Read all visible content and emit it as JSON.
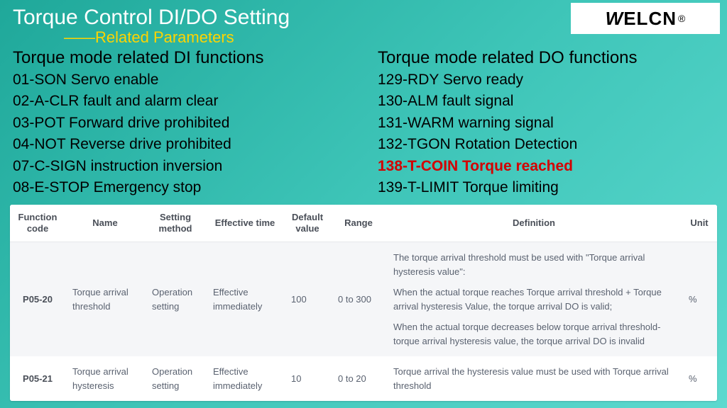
{
  "logo": {
    "mark": "W",
    "text": "ELCN",
    "reg": "®"
  },
  "title": "Torque Control DI/DO Setting",
  "subtitle": "——Related Parameters",
  "left": {
    "heading": "Torque mode related DI functions",
    "items": [
      "01-SON Servo enable",
      "02-A-CLR fault and alarm clear",
      "03-POT Forward drive prohibited",
      "04-NOT Reverse drive prohibited",
      "07-C-SIGN instruction inversion",
      "08-E-STOP Emergency stop"
    ]
  },
  "right": {
    "heading": "Torque mode related DO functions",
    "items": [
      {
        "text": "129-RDY Servo ready",
        "highlight": false
      },
      {
        "text": "130-ALM fault signal",
        "highlight": false
      },
      {
        "text": "131-WARM warning signal",
        "highlight": false
      },
      {
        "text": "132-TGON Rotation Detection",
        "highlight": false
      },
      {
        "text": "138-T-COIN Torque reached",
        "highlight": true
      },
      {
        "text": "139-T-LIMIT Torque limiting",
        "highlight": false
      }
    ]
  },
  "table": {
    "headers": [
      "Function code",
      "Name",
      "Setting method",
      "Effective time",
      "Default value",
      "Range",
      "Definition",
      "Unit"
    ],
    "rows": [
      {
        "fc": "P05-20",
        "name": "Torque arrival threshold",
        "setting": "Operation setting",
        "effective": "Effective immediately",
        "default": "100",
        "range": "0 to 300",
        "definition": [
          "The torque arrival threshold must be used with \"Torque arrival hysteresis value\":",
          "When the actual torque reaches Torque arrival threshold + Torque arrival hysteresis Value, the torque arrival DO is valid;",
          "When the actual torque decreases below torque arrival threshold-torque arrival hysteresis value, the torque arrival DO is invalid"
        ],
        "unit": "%"
      },
      {
        "fc": "P05-21",
        "name": "Torque arrival hysteresis",
        "setting": "Operation setting",
        "effective": "Effective immediately",
        "default": "10",
        "range": "0 to 20",
        "definition": [
          "Torque arrival the hysteresis value must be used with Torque arrival threshold"
        ],
        "unit": "%"
      }
    ]
  }
}
